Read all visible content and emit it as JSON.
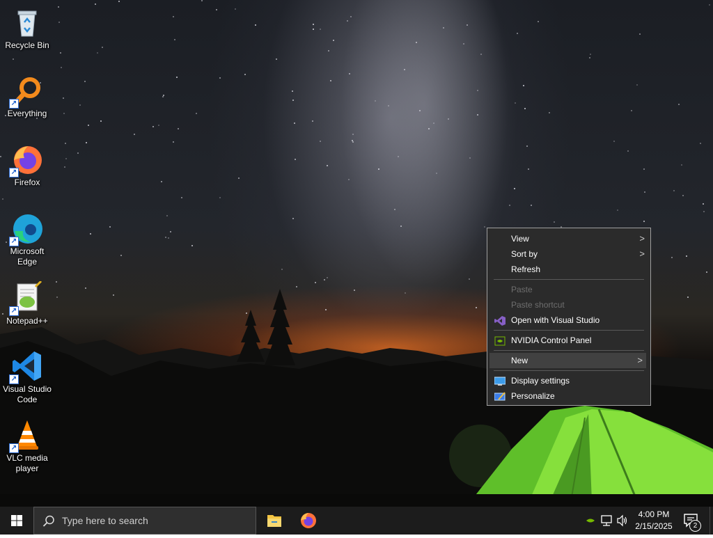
{
  "desktop": {
    "icons": [
      {
        "label": "Recycle Bin",
        "icon": "recycle-bin-icon"
      },
      {
        "label": "Everything",
        "icon": "everything-search-icon"
      },
      {
        "label": "Firefox",
        "icon": "firefox-icon"
      },
      {
        "label": "Microsoft Edge",
        "icon": "edge-icon"
      },
      {
        "label": "Notepad++",
        "icon": "notepad-plus-plus-icon"
      },
      {
        "label": "Visual Studio Code",
        "icon": "vscode-icon"
      },
      {
        "label": "VLC media player",
        "icon": "vlc-icon"
      }
    ]
  },
  "context_menu": {
    "view": "View",
    "sort_by": "Sort by",
    "refresh": "Refresh",
    "paste": "Paste",
    "paste_shortcut": "Paste shortcut",
    "open_visual_studio": "Open with Visual Studio",
    "nvidia": "NVIDIA Control Panel",
    "new": "New",
    "display_settings": "Display settings",
    "personalize": "Personalize",
    "chevron": ">"
  },
  "taskbar": {
    "search_placeholder": "Type here to search",
    "time": "4:00 PM",
    "date": "2/15/2025",
    "notification_count": "2"
  },
  "colors": {
    "menu_bg": "#2b2b2b",
    "menu_hover": "#414141",
    "taskbar_bg": "#1c1c1c",
    "nvidia_green": "#76b900",
    "vs_purple": "#865fc5"
  }
}
